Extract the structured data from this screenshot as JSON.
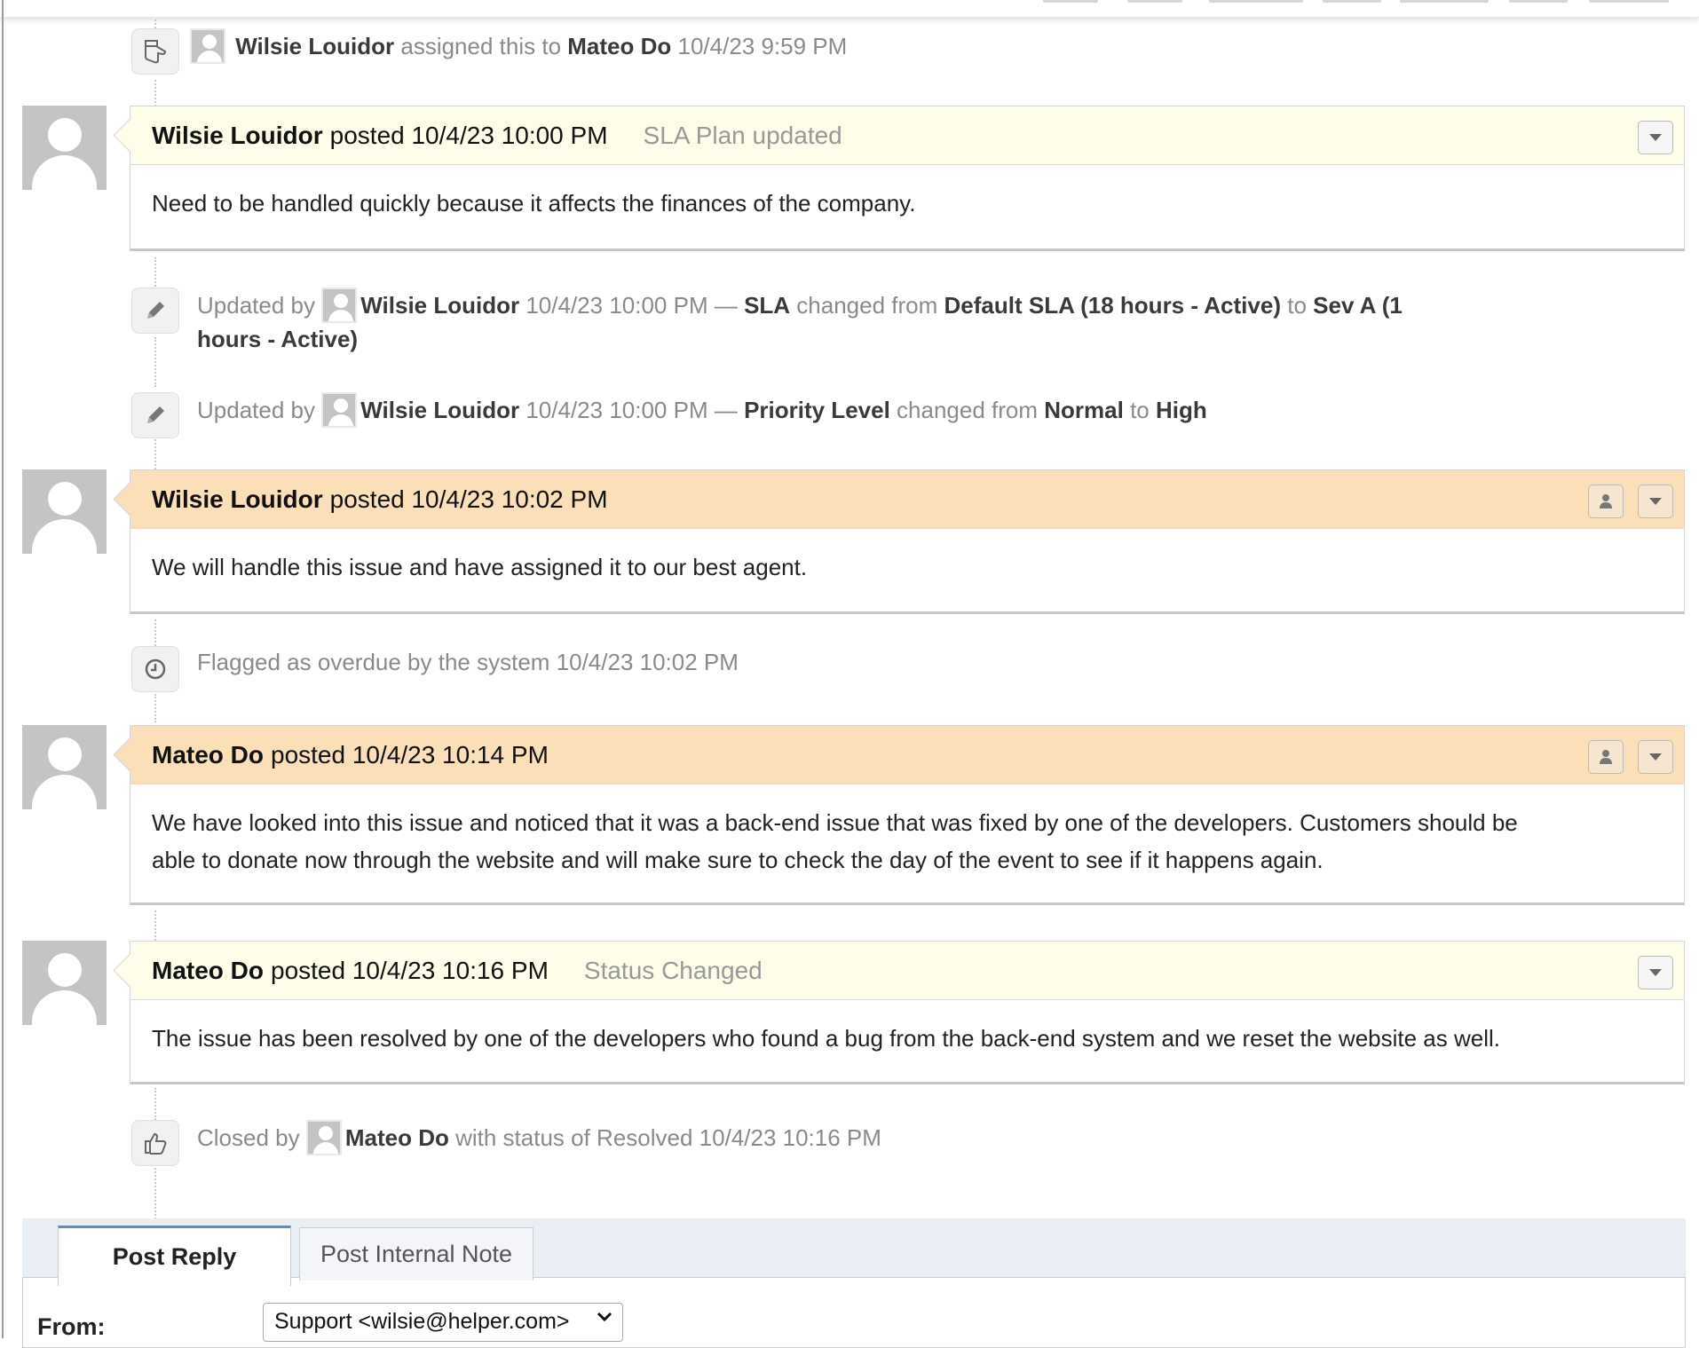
{
  "events": {
    "assigned": {
      "actor": "Wilsie Louidor",
      "action": "assigned this to",
      "target": "Mateo Do",
      "time": "10/4/23 9:59 PM"
    },
    "sla_update": {
      "prefix": "Updated by",
      "actor": "Wilsie Louidor",
      "time": "10/4/23 10:00 PM —",
      "field": "SLA",
      "changed_from": "changed from",
      "old_value": "Default SLA (18 hours - Active)",
      "to": "to",
      "new_value_line1": "Sev A (1",
      "new_value_line2": "hours - Active)"
    },
    "priority_update": {
      "prefix": "Updated by",
      "actor": "Wilsie Louidor",
      "time": "10/4/23 10:00 PM —",
      "field": "Priority Level",
      "changed_from": "changed from",
      "old_value": "Normal",
      "to": "to",
      "new_value": "High"
    },
    "overdue": {
      "text": "Flagged as overdue by the system 10/4/23 10:02 PM"
    },
    "closed": {
      "prefix": "Closed by",
      "actor": "Mateo Do",
      "suffix": "with status of Resolved 10/4/23 10:16 PM"
    }
  },
  "thread": [
    {
      "author": "Wilsie Louidor",
      "posted": "posted 10/4/23 10:00 PM",
      "title": "SLA Plan updated",
      "body": "Need to be handled quickly because it affects the finances of the company."
    },
    {
      "author": "Wilsie Louidor",
      "posted": "posted 10/4/23 10:02 PM",
      "title": "",
      "body": "We will handle this issue and have assigned it to our best agent."
    },
    {
      "author": "Mateo Do",
      "posted": "posted 10/4/23 10:14 PM",
      "title": "",
      "body_line1": "We have looked into this issue and noticed that it was a back-end issue that was fixed by one of the developers. Customers should be",
      "body_line2": "able to donate now through the website and will make sure to check the day of the event to see if it happens again."
    },
    {
      "author": "Mateo Do",
      "posted": "posted 10/4/23 10:16 PM",
      "title": "Status Changed",
      "body": "The issue has been resolved by one of the developers who found a bug from the back-end system and we reset the website as well."
    }
  ],
  "reply": {
    "tabs": [
      "Post Reply",
      "Post Internal Note"
    ],
    "from_label": "From:",
    "from_value": "Support <wilsie@helper.com>"
  },
  "colors": {
    "note_header": "#fdfde9",
    "reply_header": "#fbdfb8",
    "reply_area": "#e9eef5"
  },
  "icons": [
    "thumbs-up-icon",
    "pencil-icon",
    "clock-icon",
    "chevron-down-icon",
    "user-icon"
  ]
}
